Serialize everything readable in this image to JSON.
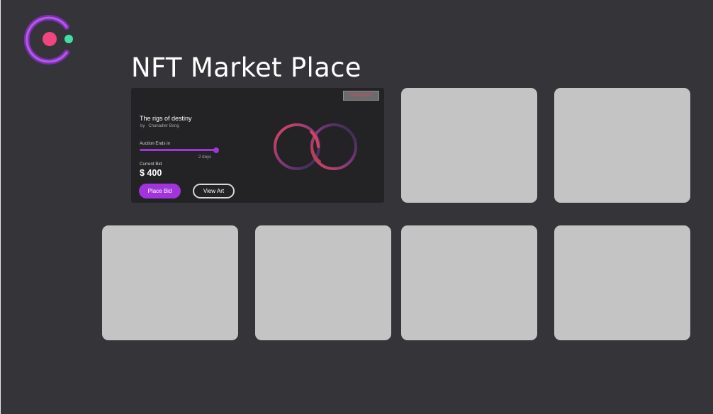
{
  "page": {
    "title": "NFT Market Place"
  },
  "featured": {
    "status": "Unfinished",
    "title": "The rigs of destiny",
    "author_prefix": "by",
    "author": "Chanadler Bong",
    "auction_label": "Auction Ends in",
    "auction_progress": 1.0,
    "time_left": "2 days",
    "bid_label": "Current Bid",
    "bid_value": "$ 400",
    "place_bid_label": "Place Bid",
    "view_art_label": "View Art"
  },
  "colors": {
    "background": "#353438",
    "card": "#232225",
    "accent": "#a234dc",
    "placeholder": "#c4c4c4",
    "logo_dot_pink": "#f0457f",
    "logo_dot_green": "#3fe0a8",
    "ring_red": "#e0455f"
  },
  "icons": {
    "logo": "brand-logo-icon",
    "art": "linked-rings-art"
  }
}
